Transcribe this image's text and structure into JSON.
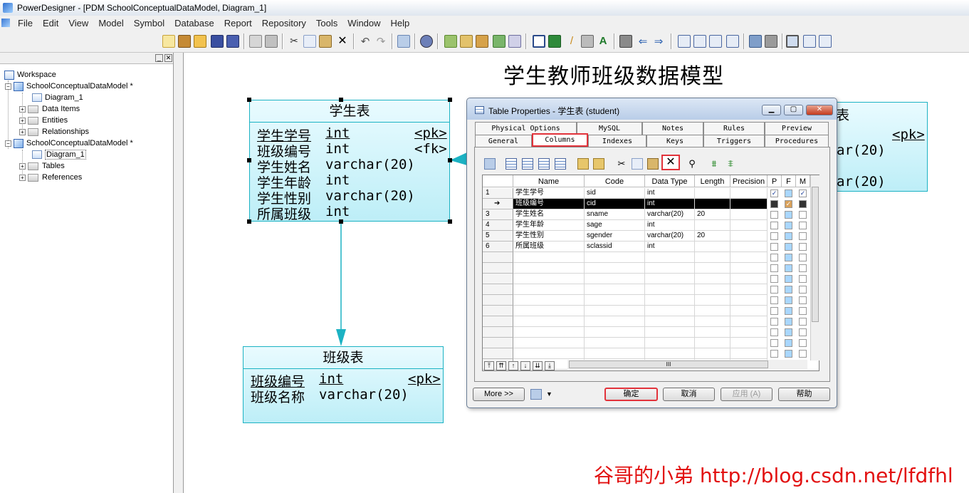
{
  "window": {
    "title": "PowerDesigner - [PDM SchoolConceptualDataModel, Diagram_1]"
  },
  "menu": [
    "File",
    "Edit",
    "View",
    "Model",
    "Symbol",
    "Database",
    "Report",
    "Repository",
    "Tools",
    "Window",
    "Help"
  ],
  "browser": {
    "items": [
      {
        "label": "Workspace"
      },
      {
        "label": "SchoolConceptualDataModel *"
      },
      {
        "label": "Diagram_1"
      },
      {
        "label": "Data Items"
      },
      {
        "label": "Entities"
      },
      {
        "label": "Relationships"
      },
      {
        "label": "SchoolConceptualDataModel *"
      },
      {
        "label": "Diagram_1"
      },
      {
        "label": "Tables"
      },
      {
        "label": "References"
      }
    ]
  },
  "diagram": {
    "title": "学生教师班级数据模型",
    "student_table": {
      "name": "学生表",
      "rows": [
        {
          "col": "学生学号",
          "type": "int",
          "key": "<pk>"
        },
        {
          "col": "班级编号",
          "type": "int",
          "key": "<fk>"
        },
        {
          "col": "学生姓名",
          "type": "varchar(20)",
          "key": ""
        },
        {
          "col": "学生年龄",
          "type": "int",
          "key": ""
        },
        {
          "col": "学生性别",
          "type": "varchar(20)",
          "key": ""
        },
        {
          "col": "所属班级",
          "type": "int",
          "key": ""
        }
      ]
    },
    "class_table": {
      "name": "班级表",
      "rows": [
        {
          "col": "班级编号",
          "type": "int",
          "key": "<pk>"
        },
        {
          "col": "班级名称",
          "type": "varchar(20)",
          "key": ""
        }
      ]
    },
    "partial_table": {
      "name_fragment": "表",
      "key": "<pk>",
      "type1": "ar(20)",
      "type2": "ar(20)"
    }
  },
  "dialog": {
    "title": "Table Properties - 学生表 (student)",
    "tabs_row1": [
      "Physical Options",
      "MySQL",
      "Notes",
      "Rules",
      "Preview"
    ],
    "tabs_row2": [
      "General",
      "Columns",
      "Indexes",
      "Keys",
      "Triggers",
      "Procedures"
    ],
    "grid": {
      "headers": [
        "Name",
        "Code",
        "Data Type",
        "Length",
        "Precision",
        "P",
        "F",
        "M"
      ],
      "rows": [
        {
          "num": "1",
          "name": "学生学号",
          "code": "sid",
          "type": "int",
          "length": "",
          "p": true,
          "f": false,
          "m": true
        },
        {
          "num": "➔",
          "name": "班级编号",
          "code": "cid",
          "type": "int",
          "length": "",
          "p": false,
          "f": true,
          "m": false
        },
        {
          "num": "3",
          "name": "学生姓名",
          "code": "sname",
          "type": "varchar(20)",
          "length": "20",
          "p": false,
          "f": false,
          "m": false
        },
        {
          "num": "4",
          "name": "学生年龄",
          "code": "sage",
          "type": "int",
          "length": "",
          "p": false,
          "f": false,
          "m": false
        },
        {
          "num": "5",
          "name": "学生性别",
          "code": "sgender",
          "type": "varchar(20)",
          "length": "20",
          "p": false,
          "f": false,
          "m": false
        },
        {
          "num": "6",
          "name": "所属班级",
          "code": "sclassid",
          "type": "int",
          "length": "",
          "p": false,
          "f": false,
          "m": false
        }
      ],
      "hscroll_label": "III"
    },
    "buttons": {
      "more": "More >>",
      "ok": "确定",
      "cancel": "取消",
      "apply": "应用 (A)",
      "help": "帮助"
    }
  },
  "watermark": "谷哥的小弟 http://blog.csdn.net/lfdfhl"
}
